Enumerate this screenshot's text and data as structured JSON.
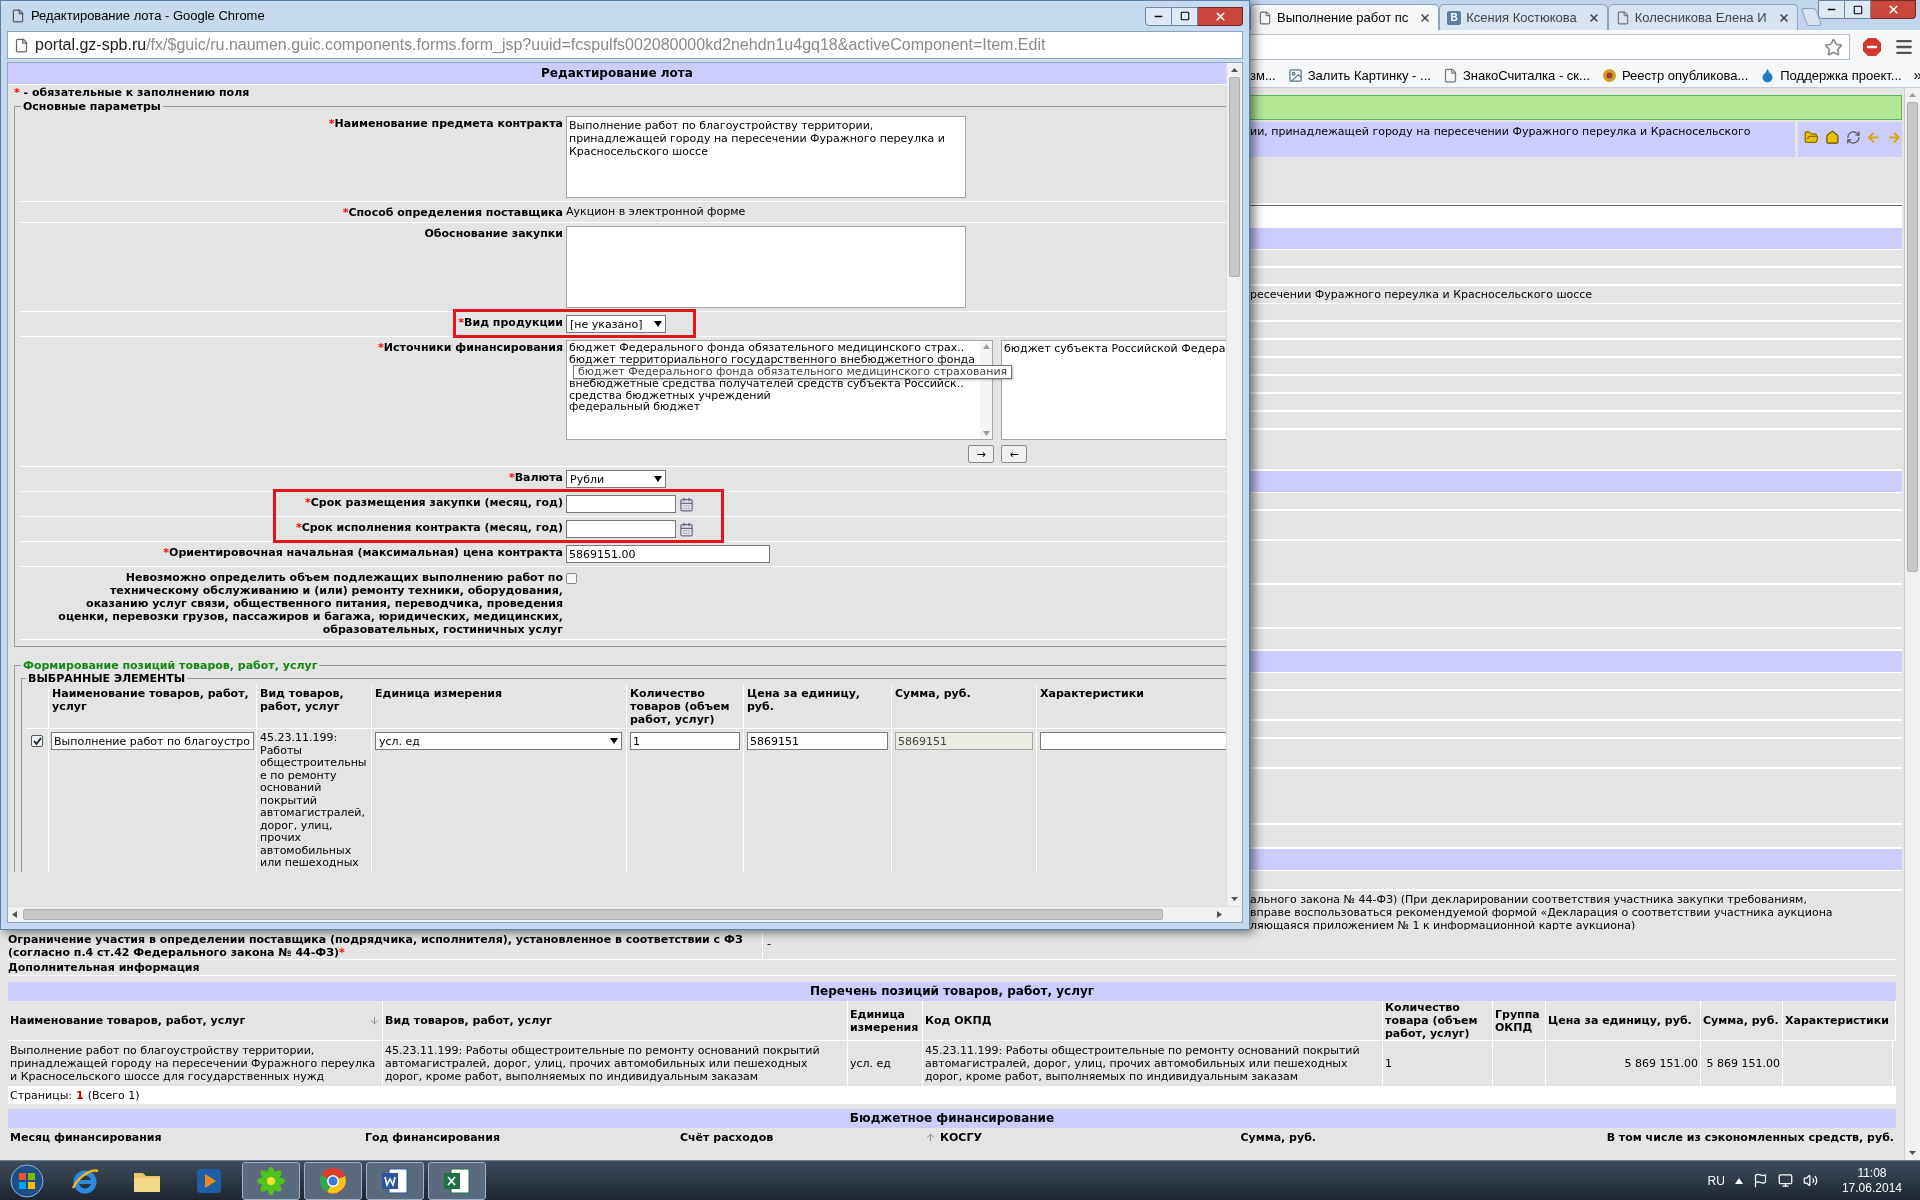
{
  "popup": {
    "title": "Редактирование лота - Google Chrome",
    "url": {
      "host": "portal.gz-spb.ru",
      "path": "/fx/$guic/ru.naumen.guic.components.forms.form_jsp?uuid=fcspulfs002080000kd2nehdn1u4gq18&activeComponent=Item.Edit"
    },
    "form_title": "Редактирование лота",
    "required_note": {
      "mark": "*",
      "text": " - обязательные к заполнению поля"
    },
    "main_section": {
      "legend": "Основные параметры",
      "fields": [
        {
          "kind": "textarea",
          "label": "Наименование предмета контракта",
          "required": true,
          "highlighted": false,
          "value": "Выполнение работ по благоустройству территории, принадлежащей городу на пересечении Фуражного переулка и Красносельского шоссе"
        },
        {
          "kind": "static",
          "label": "Способ определения поставщика",
          "required": true,
          "highlighted": false,
          "value": "Аукцион в электронной форме"
        },
        {
          "kind": "textarea",
          "label": "Обоснование закупки",
          "required": false,
          "highlighted": false
        },
        {
          "kind": "select",
          "label": "Вид продукции",
          "required": true,
          "highlighted": true,
          "value": "[не указано]"
        },
        {
          "kind": "dual_list",
          "label": "Источники финансирования",
          "required": true,
          "highlighted": false,
          "available": [
            {
              "kind": "option",
              "text": "бюджет Федерального фонда обязательного медицинского страх.."
            },
            {
              "kind": "option",
              "text": "бюджет территориального государственного внебюджетного фонда"
            },
            {
              "kind": "tooltip",
              "text": "бюджет Федерального фонда обязательного медицинского страхования"
            },
            {
              "kind": "option",
              "text": "внебюджетные средства получателей средств субъекта Российск.."
            },
            {
              "kind": "option",
              "text": "средства бюджетных учреждений"
            },
            {
              "kind": "option",
              "text": "федеральный бюджет"
            }
          ],
          "chosen": [
            "бюджет субъекта Российской Федера"
          ],
          "buttons": [
            "→",
            "←"
          ]
        },
        {
          "kind": "select",
          "label": "Валюта",
          "required": true,
          "highlighted": false,
          "value": "Рубли"
        },
        {
          "kind": "date",
          "label": "Срок размещения закупки (месяц, год)",
          "required": true,
          "highlighted": true
        },
        {
          "kind": "date",
          "label": "Срок исполнения контракта (месяц, год)",
          "required": true,
          "highlighted": true
        },
        {
          "kind": "input",
          "label": "Ориентировочная начальная (максимальная) цена контракта",
          "required": true,
          "highlighted": false,
          "value": "5869151.00"
        },
        {
          "kind": "checkbox",
          "label_lines": [
            "Невозможно определить объем подлежащих выполнению работ по",
            "техническому обслуживанию и (или) ремонту техники, оборудования,",
            "оказанию услуг связи, общественного питания, переводчика, проведения",
            "оценки, перевозки грузов, пассажиров и багажа, юридических, медицинских,",
            "образовательных, гостиничных услуг"
          ],
          "required": false,
          "highlighted": false,
          "checked": false
        }
      ]
    },
    "items_section": {
      "legend": "Формирование позиций товаров, работ, услуг",
      "subsection": "ВЫБРАННЫЕ ЭЛЕМЕНТЫ",
      "columns": [
        "Наименование товаров, работ, услуг",
        "Вид товаров, работ, услуг",
        "Единица измерения",
        "Количество товаров (объем работ, услуг)",
        "Цена за единицу, руб.",
        "Сумма, руб.",
        "Характеристики"
      ],
      "rows": [
        {
          "checked": true,
          "name": "Выполнение работ по благоустро",
          "type": "45.23.11.199: Работы общестроительные по ремонту оснований покрытий автомагистралей, дорог, улиц, прочих автомобильных или пешеходных",
          "unit": "усл. ед",
          "quantity": "1",
          "price": "5869151",
          "sum": "5869151"
        }
      ]
    }
  },
  "browser": {
    "tabs": [
      {
        "title": "Выполнение работ пс",
        "selected": true,
        "kind": "page"
      },
      {
        "title": "Ксения Костюкова",
        "selected": false,
        "kind": "social",
        "icon_text": "B"
      },
      {
        "title": "Колесникова Елена И",
        "selected": false,
        "kind": "page"
      }
    ],
    "bookmarks": [
      {
        "title": "зм...",
        "kind": "plain"
      },
      {
        "title": "Залить Картинку - ...",
        "kind": "image"
      },
      {
        "title": "ЗнакоСчиталка - ск...",
        "kind": "page"
      },
      {
        "title": "Реестр опубликова...",
        "kind": "emblem"
      },
      {
        "title": "Поддержка проект...",
        "kind": "drop"
      }
    ],
    "bookmarks_more": "»"
  },
  "page": {
    "lot_title_fragment": "ии, принадлежащей городу на пересечении Фуражного переулка и Красносельского",
    "subject_fragment": "ресечении Фуражного переулка и Красносельского шоссе",
    "note_fragment": [
      "ального закона № 44-ФЗ) (При декларировании соответствия участника закупки требованиям,",
      "вправе воспользоваться рекомендуемой формой «Декларация о соответствии участника аукциона",
      "ляющаяся приложением № 1 к информационной карте аукциона)"
    ],
    "restriction": {
      "label": "Ограничение участия в определении поставщика (подрядчика, исполнителя), установленное в соответствии с ФЗ (согласно п.4 ст.42 Федерального закона № 44-ФЗ)",
      "mark": "*",
      "value": "-"
    },
    "additional_info": "Дополнительная информация",
    "positions": {
      "title": "Перечень позиций товаров, работ, услуг",
      "columns": [
        {
          "title": "Наименование товаров, работ, услуг",
          "sorted": true,
          "descending": true
        },
        {
          "title": "Вид товаров, работ, услуг",
          "sorted": false
        },
        {
          "title": "Единица измерения",
          "sorted": false
        },
        {
          "title": "Код ОКПД",
          "sorted": false
        },
        {
          "title": "Количество товара (объем работ, услуг)",
          "sorted": false
        },
        {
          "title": "Группа ОКПД",
          "sorted": false
        },
        {
          "title": "Цена за единицу, руб.",
          "kind": "money",
          "sorted": false
        },
        {
          "title": "Сумма, руб.",
          "kind": "money",
          "sorted": false
        },
        {
          "title": "Характеристики",
          "sorted": false
        }
      ],
      "rows": [
        [
          "Выполнение работ по благоустройству территории, принадлежащей городу на пересечении Фуражного переулка и Красносельского шоссе для государственных нужд",
          "45.23.11.199: Работы общестроительные по ремонту оснований покрытий автомагистралей, дорог, улиц, прочих автомобильных или пешеходных дорог, кроме работ, выполняемых по индивидуальным заказам",
          "усл. ед",
          "45.23.11.199: Работы общестроительные по ремонту оснований покрытий автомагистралей, дорог, улиц, прочих автомобильных или пешеходных дорог, кроме работ, выполняемых по индивидуальным заказам",
          "1",
          null,
          "5 869 151.00",
          "5 869 151.00",
          null
        ]
      ],
      "pages_label": "Страницы:",
      "current_page": "1",
      "pages_total": "(Всего 1)"
    },
    "budget": {
      "title": "Бюджетное финансирование",
      "columns": [
        {
          "title": "Месяц финансирования",
          "sorted": false
        },
        {
          "title": "Год финансирования",
          "sorted": false
        },
        {
          "title": "Счёт расходов",
          "sorted": true,
          "descending": false
        },
        {
          "title": "КОСГУ",
          "sorted": false
        },
        {
          "title": "Сумма, руб.",
          "kind": "money",
          "sorted": false
        },
        {
          "title": "В том числе из сэкономленных средств, руб.",
          "kind": "money",
          "sorted": false
        }
      ]
    }
  },
  "taskbar": {
    "apps": [
      {
        "kind": "ie",
        "running": false
      },
      {
        "kind": "explorer",
        "running": false
      },
      {
        "kind": "media",
        "running": false
      },
      {
        "kind": "icq",
        "running": true
      },
      {
        "kind": "chrome",
        "running": true
      },
      {
        "kind": "word",
        "running": true
      },
      {
        "kind": "excel",
        "running": true
      }
    ],
    "language": "RU",
    "time": "11:08",
    "date": "17.06.2014"
  }
}
